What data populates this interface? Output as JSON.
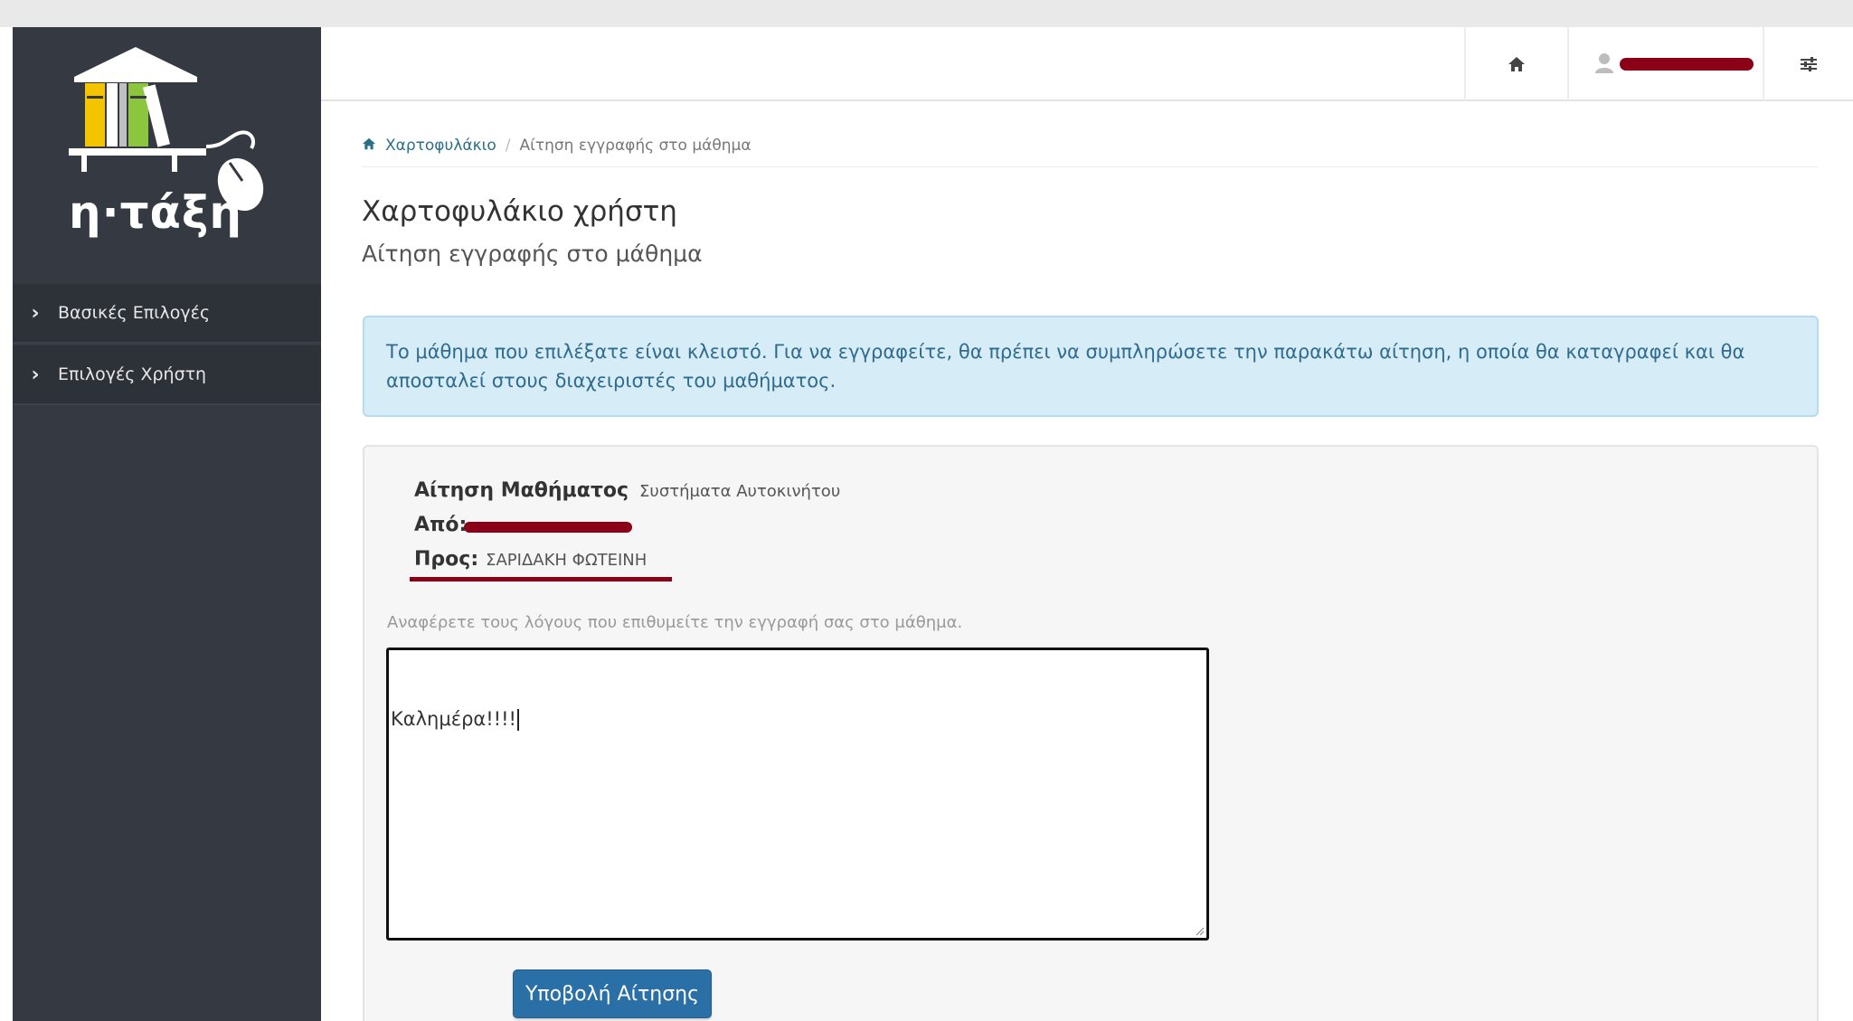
{
  "app": {
    "logo_text": "η·τάξη"
  },
  "sidebar": {
    "items": [
      {
        "label": "Βασικές Επιλογές"
      },
      {
        "label": "Επιλογές Χρήστη"
      }
    ]
  },
  "topbar": {
    "home_icon": "home-icon",
    "user_icon": "user-icon",
    "settings_icon": "sliders-icon"
  },
  "breadcrumb": {
    "home": "Χαρτοφυλάκιο",
    "current": "Αίτηση εγγραφής στο μάθημα",
    "separator": "/"
  },
  "page": {
    "title": "Χαρτοφυλάκιο χρήστη",
    "subtitle": "Αίτηση εγγραφής στο μάθημα"
  },
  "alert": {
    "text": "Το μάθημα που επιλέξατε είναι κλειστό. Για να εγγραφείτε, θα πρέπει να συμπληρώσετε την παρακάτω αίτηση, η οποία θα καταγραφεί και θα αποσταλεί στους διαχειριστές του μαθήματος."
  },
  "form": {
    "course_label": "Αίτηση Μαθήματος",
    "course_value": "Συστήματα Αυτοκινήτου",
    "from_label": "Από:",
    "to_label": "Προς:",
    "to_value": "ΣΑΡΙΔΑΚΗ ΦΩΤΕΙΝΗ",
    "hint": "Αναφέρετε τους λόγους που επιθυμείτε την εγγραφή σας στο μάθημα.",
    "message": "Καλημέρα!!!!",
    "submit_label": "Υποβολή Αίτησης"
  },
  "colors": {
    "sidebar_bg": "#353a42",
    "accent": "#2a6fa5",
    "alert_bg": "#d6ecf7",
    "redaction": "#8b0016"
  }
}
